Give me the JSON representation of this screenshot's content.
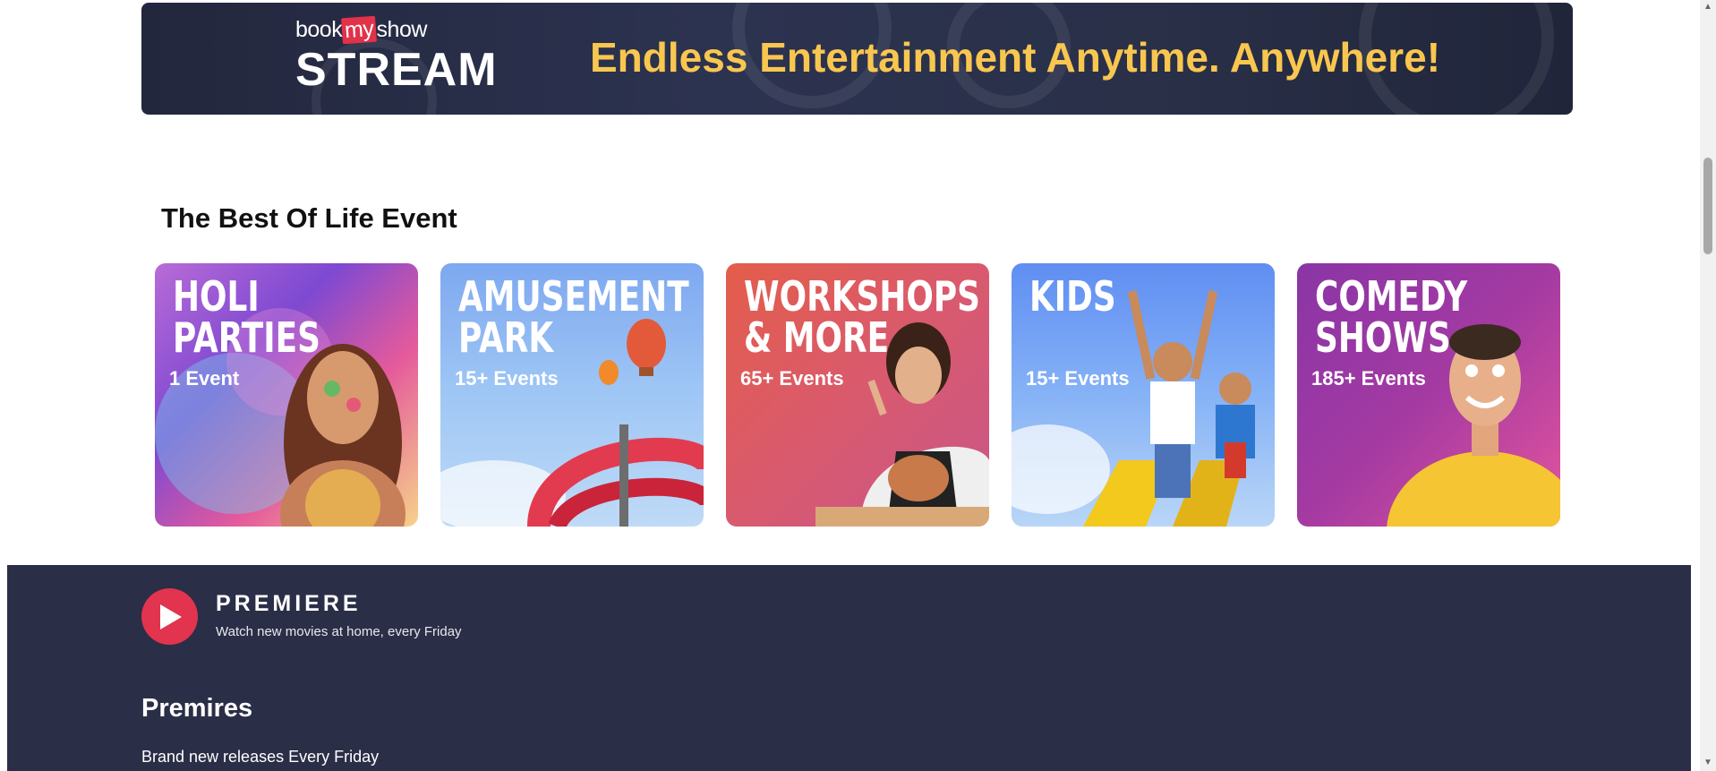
{
  "banner": {
    "logo_book": "book",
    "logo_my": "my",
    "logo_show": "show",
    "logo_stream": "STREAM",
    "tagline": "Endless Entertainment Anytime. Anywhere!",
    "tagline_color": "#f9c74f"
  },
  "events_section": {
    "title": "The Best Of Life Event",
    "cards": [
      {
        "title_line1": "HOLI",
        "title_line2": "PARTIES",
        "count": "1 Event"
      },
      {
        "title_line1": "AMUSEMENT",
        "title_line2": "PARK",
        "count": "15+ Events"
      },
      {
        "title_line1": "WORKSHOPS",
        "title_line2": "& MORE",
        "count": "65+ Events"
      },
      {
        "title_line1": "KIDS",
        "title_line2": "",
        "count": "15+ Events"
      },
      {
        "title_line1": "COMEDY",
        "title_line2": "SHOWS",
        "count": "185+ Events"
      }
    ]
  },
  "premiere": {
    "brand": "PREMIERE",
    "subtitle": "Watch new movies at home, every Friday",
    "section_title": "Premires",
    "section_subtitle": "Brand new releases Every Friday",
    "background_color": "#2b2e47",
    "accent_color": "#e2334f"
  }
}
